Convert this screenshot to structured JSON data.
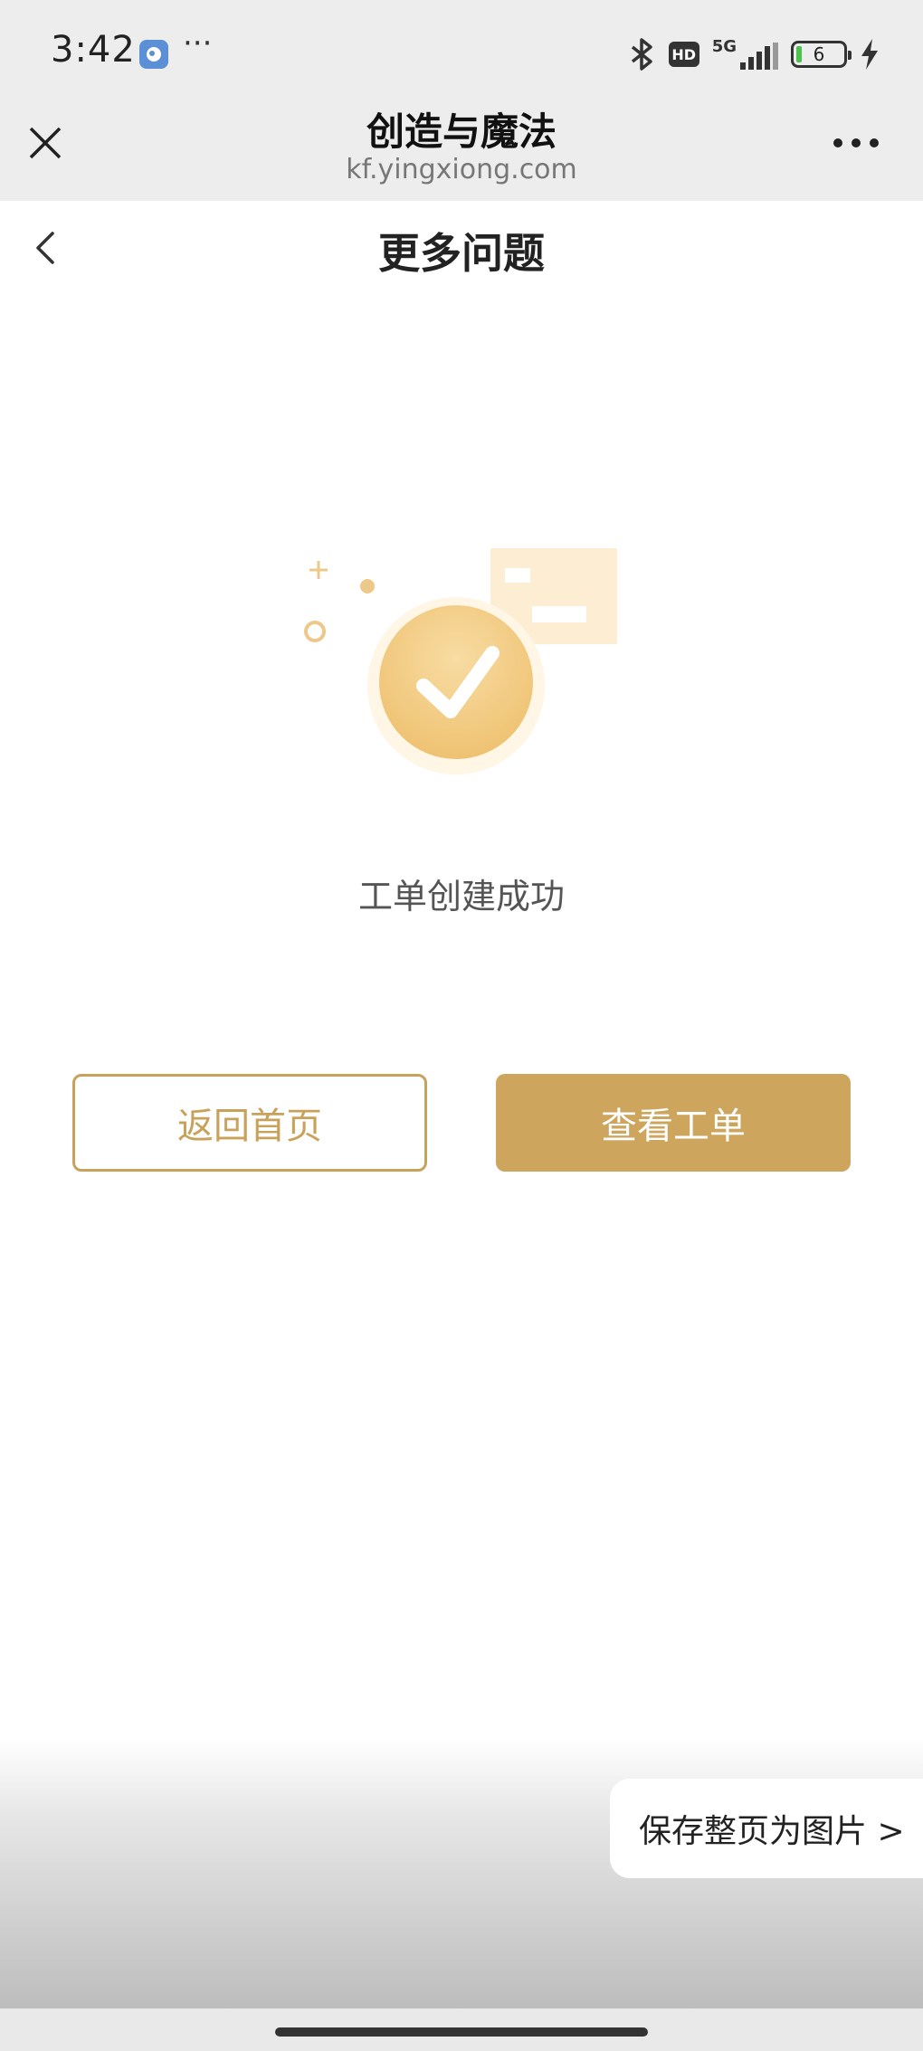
{
  "status_bar": {
    "time": "3:42",
    "more": "···",
    "hd": "HD",
    "network": "5G",
    "battery": "6",
    "icons": [
      "browser-badge-icon",
      "bluetooth-icon",
      "signal-icon",
      "battery-icon",
      "charging-icon"
    ]
  },
  "header": {
    "title": "创造与魔法",
    "url": "kf.yingxiong.com",
    "icons": [
      "close-icon",
      "more-icon"
    ]
  },
  "nav": {
    "title": "更多问题",
    "icon": "back-arrow-icon"
  },
  "result": {
    "message": "工单创建成功",
    "icon": "success-check-icon",
    "accent": "#cda55c",
    "accent_light": "#f5d79b"
  },
  "actions": {
    "back_home": "返回首页",
    "view_ticket": "查看工单"
  },
  "save_tab": {
    "label": "保存整页为图片 >"
  }
}
